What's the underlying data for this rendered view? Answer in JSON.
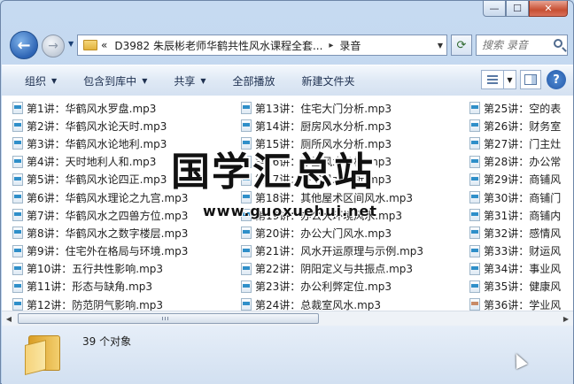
{
  "window": {
    "caption": {
      "minimize": "—",
      "maximize": "☐",
      "close": "✕"
    }
  },
  "nav": {
    "back_glyph": "←",
    "forward_glyph": "→",
    "breadcrumb": {
      "lead": "«",
      "parent": "D3982 朱辰彬老师华鹤共性风水课程全套...",
      "current": "录音",
      "sep": "▸"
    },
    "search_placeholder": "搜索 录音"
  },
  "toolbar": {
    "organize": "组织",
    "include_library": "包含到库中",
    "share": "共享",
    "play_all": "全部播放",
    "new_folder": "新建文件夹"
  },
  "files": {
    "col1": [
      "第1讲：华鹤风水罗盘.mp3",
      "第2讲：华鹤风水论天时.mp3",
      "第3讲：华鹤风水论地利.mp3",
      "第4讲：天时地利人和.mp3",
      "第5讲：华鹤风水论四正.mp3",
      "第6讲：华鹤风水理论之九宫.mp3",
      "第7讲：华鹤风水之四兽方位.mp3",
      "第8讲：华鹤风水之数字楼层.mp3",
      "第9讲：住宅外在格局与环境.mp3",
      "第10讲：五行共性影响.mp3",
      "第11讲：形态与缺角.mp3",
      "第12讲：防范阴气影响.mp3"
    ],
    "col2": [
      "第13讲：住宅大门分析.mp3",
      "第14讲：厨房风水分析.mp3",
      "第15讲：厕所风水分析.mp3",
      "第16讲：厅堂风水分析.mp3",
      "第17讲：卧室风水分析.mp3",
      "第18讲：其他屋术区间风水.mp3",
      "第19讲：办公大环境风水.mp3",
      "第20讲：办公大门风水.mp3",
      "第21讲：风水开运原理与示例.mp3",
      "第22讲：阴阳定义与共振点.mp3",
      "第23讲：办公利弊定位.mp3",
      "第24讲：总裁室风水.mp3"
    ],
    "col3": [
      "第25讲：空的表",
      "第26讲：财务室",
      "第27讲：门主灶",
      "第28讲：办公常",
      "第29讲：商铺风",
      "第30讲：商铺门",
      "第31讲：商铺内",
      "第32讲：感情风",
      "第33讲：财运风",
      "第34讲：事业风",
      "第35讲：健康风",
      "第36讲：学业风"
    ]
  },
  "scrollbar": {
    "left": "◀",
    "right": "▶",
    "position": 0.0
  },
  "details": {
    "count_text": "39 个对象"
  },
  "watermark": {
    "title": "国学汇总站",
    "url": "www.guoxuehui.net"
  }
}
